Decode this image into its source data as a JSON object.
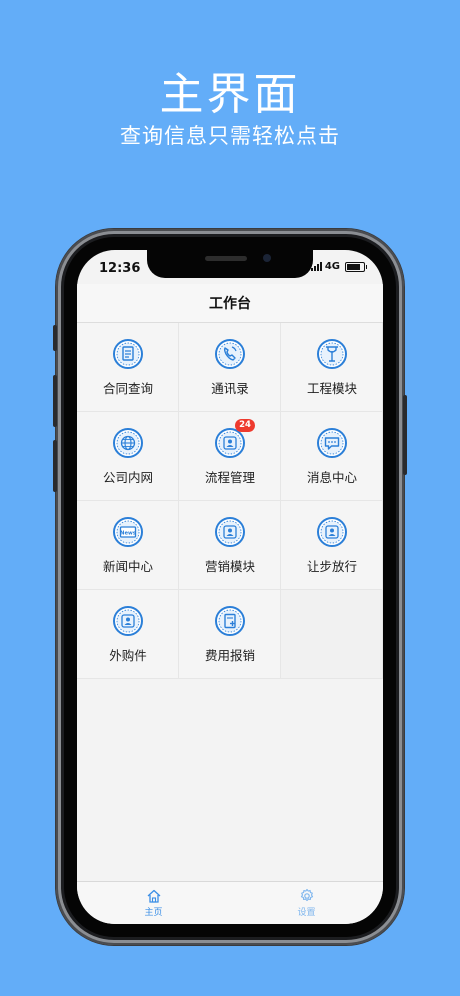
{
  "promo": {
    "headline": "主界面",
    "subline": "查询信息只需轻松点击"
  },
  "status_bar": {
    "time": "12:36",
    "network": "4G"
  },
  "navbar": {
    "title": "工作台"
  },
  "modules": [
    {
      "label": "合同查询",
      "icon": "contract-doc-icon"
    },
    {
      "label": "通讯录",
      "icon": "phone-contacts-icon"
    },
    {
      "label": "工程模块",
      "icon": "engineering-icon"
    },
    {
      "label": "公司内网",
      "icon": "globe-icon"
    },
    {
      "label": "流程管理",
      "icon": "process-person-icon",
      "badge": "24"
    },
    {
      "label": "消息中心",
      "icon": "message-chat-icon"
    },
    {
      "label": "新闻中心",
      "icon": "news-icon"
    },
    {
      "label": "营销模块",
      "icon": "marketing-person-icon"
    },
    {
      "label": "让步放行",
      "icon": "concession-person-icon"
    },
    {
      "label": "外购件",
      "icon": "purchase-person-icon"
    },
    {
      "label": "费用报销",
      "icon": "expense-doc-icon"
    }
  ],
  "tabbar": {
    "tabs": [
      {
        "label": "主页",
        "icon": "home-icon",
        "active": true
      },
      {
        "label": "设置",
        "icon": "gear-icon",
        "active": false
      }
    ]
  },
  "colors": {
    "background": "#63adf8",
    "icon_blue": "#2b7fd8",
    "badge_red": "#ee3a2e",
    "tab_active": "#3a8ee6"
  }
}
